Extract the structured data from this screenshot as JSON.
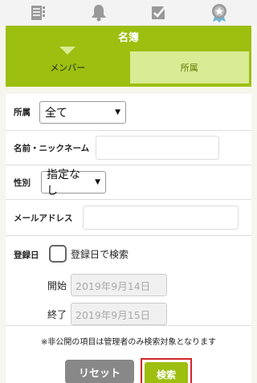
{
  "nav": {
    "icons": [
      "list-icon",
      "bell-icon",
      "check-icon",
      "badge-icon"
    ]
  },
  "header": {
    "title": "名簿"
  },
  "tabs": [
    {
      "label": "メンバー",
      "active": true
    },
    {
      "label": "所属",
      "active": false
    }
  ],
  "form": {
    "affiliation": {
      "label": "所属",
      "value": "全て"
    },
    "name": {
      "label": "名前・ニックネーム",
      "value": ""
    },
    "gender": {
      "label": "性別",
      "value": "指定なし"
    },
    "email": {
      "label": "メールアドレス",
      "value": ""
    },
    "registration": {
      "label": "登録日",
      "checkbox_label": "登録日で検索",
      "checked": false,
      "start_label": "開始",
      "start_placeholder": "2019年9月14日",
      "end_label": "終了",
      "end_placeholder": "2019年9月15日"
    },
    "note": "※非公開の項目は管理者のみ検索対象となります"
  },
  "actions": {
    "reset_label": "リセット",
    "search_label": "検索"
  },
  "colors": {
    "accent": "#9cbf10",
    "accent_light": "#d9eb94",
    "highlight": "#d2262b"
  }
}
